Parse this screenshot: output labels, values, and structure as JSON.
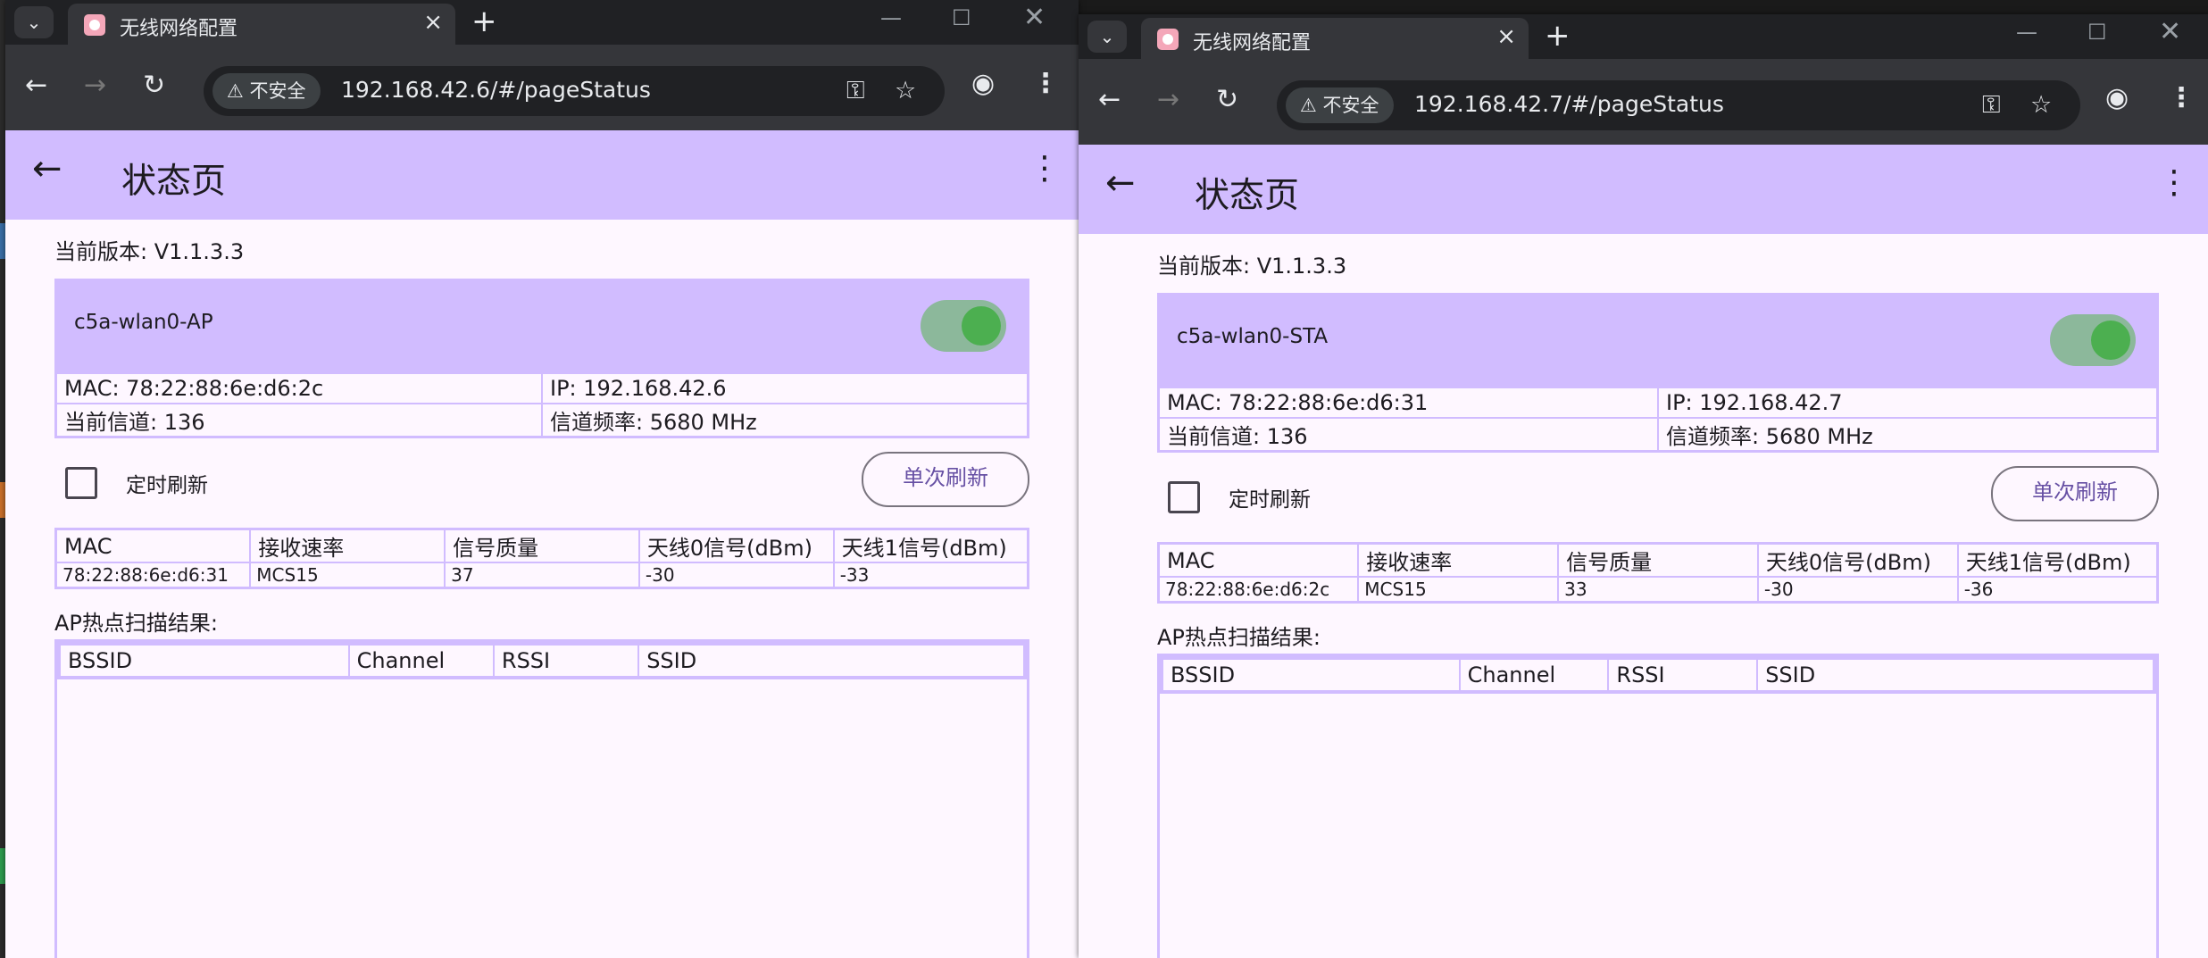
{
  "windows": [
    {
      "tab": {
        "title": "无线网络配置"
      },
      "omnibox": {
        "security": "不安全",
        "url": "192.168.42.6/#/pageStatus"
      },
      "page": {
        "title": "状态页",
        "version": "当前版本: V1.1.3.3",
        "iface": {
          "name": "c5a-wlan0-AP",
          "enabled": true
        },
        "info": {
          "mac": "MAC: 78:22:88:6e:d6:2c",
          "ip": "IP: 192.168.42.6",
          "channel": "当前信道: 136",
          "freq": "信道频率: 5680 MHz"
        },
        "timed_refresh": {
          "label": "定时刷新",
          "checked": false
        },
        "refresh_button": "单次刷新",
        "stations": {
          "headers": [
            "MAC",
            "接收速率",
            "信号质量",
            "天线0信号(dBm)",
            "天线1信号(dBm)"
          ],
          "row": [
            "78:22:88:6e:d6:31",
            "MCS15",
            "37",
            "-30",
            "-33"
          ]
        },
        "scan": {
          "title": "AP热点扫描结果:",
          "headers": [
            "BSSID",
            "Channel",
            "RSSI",
            "SSID"
          ]
        }
      }
    },
    {
      "tab": {
        "title": "无线网络配置"
      },
      "omnibox": {
        "security": "不安全",
        "url": "192.168.42.7/#/pageStatus"
      },
      "page": {
        "title": "状态页",
        "version": "当前版本: V1.1.3.3",
        "iface": {
          "name": "c5a-wlan0-STA",
          "enabled": true
        },
        "info": {
          "mac": "MAC: 78:22:88:6e:d6:31",
          "ip": "IP: 192.168.42.7",
          "channel": "当前信道: 136",
          "freq": "信道频率: 5680 MHz"
        },
        "timed_refresh": {
          "label": "定时刷新",
          "checked": false
        },
        "refresh_button": "单次刷新",
        "stations": {
          "headers": [
            "MAC",
            "接收速率",
            "信号质量",
            "天线0信号(dBm)",
            "天线1信号(dBm)"
          ],
          "row": [
            "78:22:88:6e:d6:2c",
            "MCS15",
            "33",
            "-30",
            "-36"
          ]
        },
        "scan": {
          "title": "AP热点扫描结果:",
          "headers": [
            "BSSID",
            "Channel",
            "RSSI",
            "SSID"
          ]
        }
      }
    }
  ],
  "icons": {
    "tab_search": "chevron-down-icon",
    "close": "close-icon",
    "new_tab": "plus-icon",
    "minimize": "minimize-icon",
    "maximize": "maximize-icon",
    "window_close": "close-icon",
    "back": "arrow-left-icon",
    "forward": "arrow-right-icon",
    "reload": "reload-icon",
    "warning": "warning-icon",
    "key": "key-icon",
    "star": "star-icon",
    "profile": "profile-icon",
    "menu": "more-vert-icon"
  },
  "colors": {
    "app_bar": "#d1bcff",
    "page_bg": "#fef7ff",
    "toggle_knob": "#4caf50",
    "toggle_track": "#8cb89b",
    "button_text": "#6750a4",
    "browser_frame": "#202124",
    "browser_toolbar": "#35363a"
  }
}
